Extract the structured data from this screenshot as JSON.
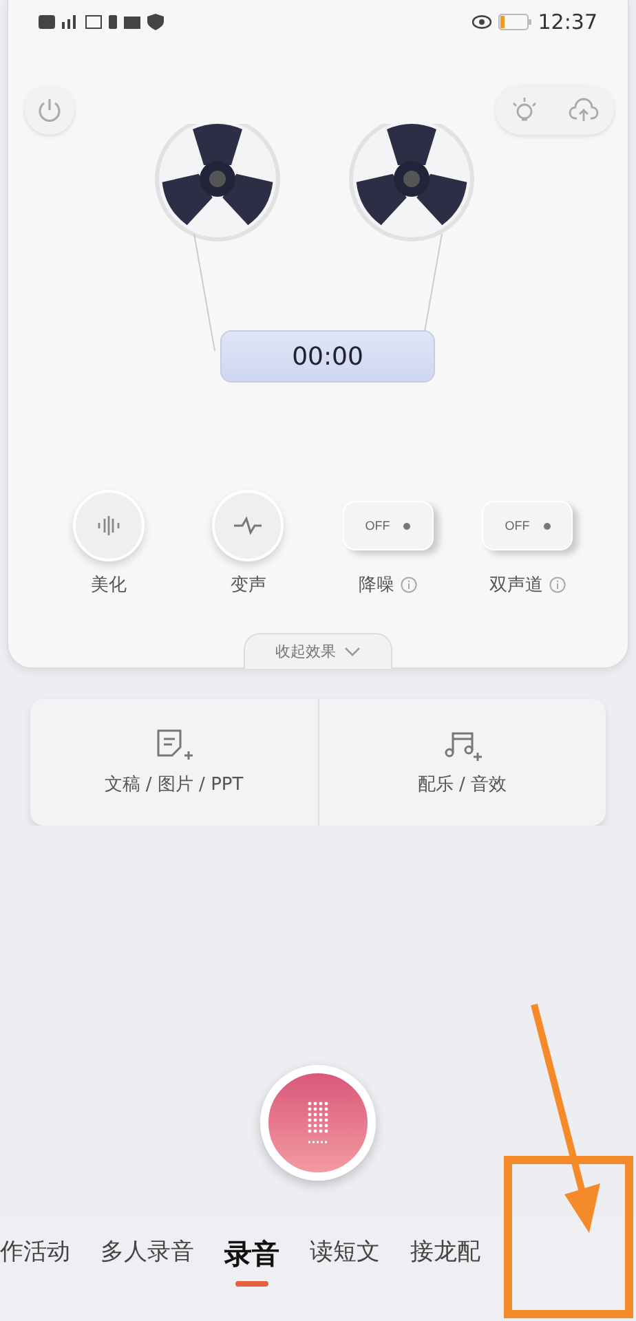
{
  "status_bar": {
    "time": "12:37"
  },
  "timer": "00:00",
  "effects": [
    {
      "kind": "round",
      "label": "美化"
    },
    {
      "kind": "round",
      "label": "变声"
    },
    {
      "kind": "switch",
      "label": "降噪",
      "switch_text": "OFF",
      "on": false
    },
    {
      "kind": "switch",
      "label": "双声道",
      "switch_text": "OFF",
      "on": false
    }
  ],
  "collapse": "收起效果",
  "actions": [
    {
      "label": "文稿 / 图片 / PPT"
    },
    {
      "label": "配乐 / 音效"
    }
  ],
  "tabs": [
    {
      "label": "作活动",
      "selected": false
    },
    {
      "label": "多人录音",
      "selected": false
    },
    {
      "label": "录音",
      "selected": true
    },
    {
      "label": "读短文",
      "selected": false
    },
    {
      "label": "接龙配",
      "selected": false
    }
  ]
}
